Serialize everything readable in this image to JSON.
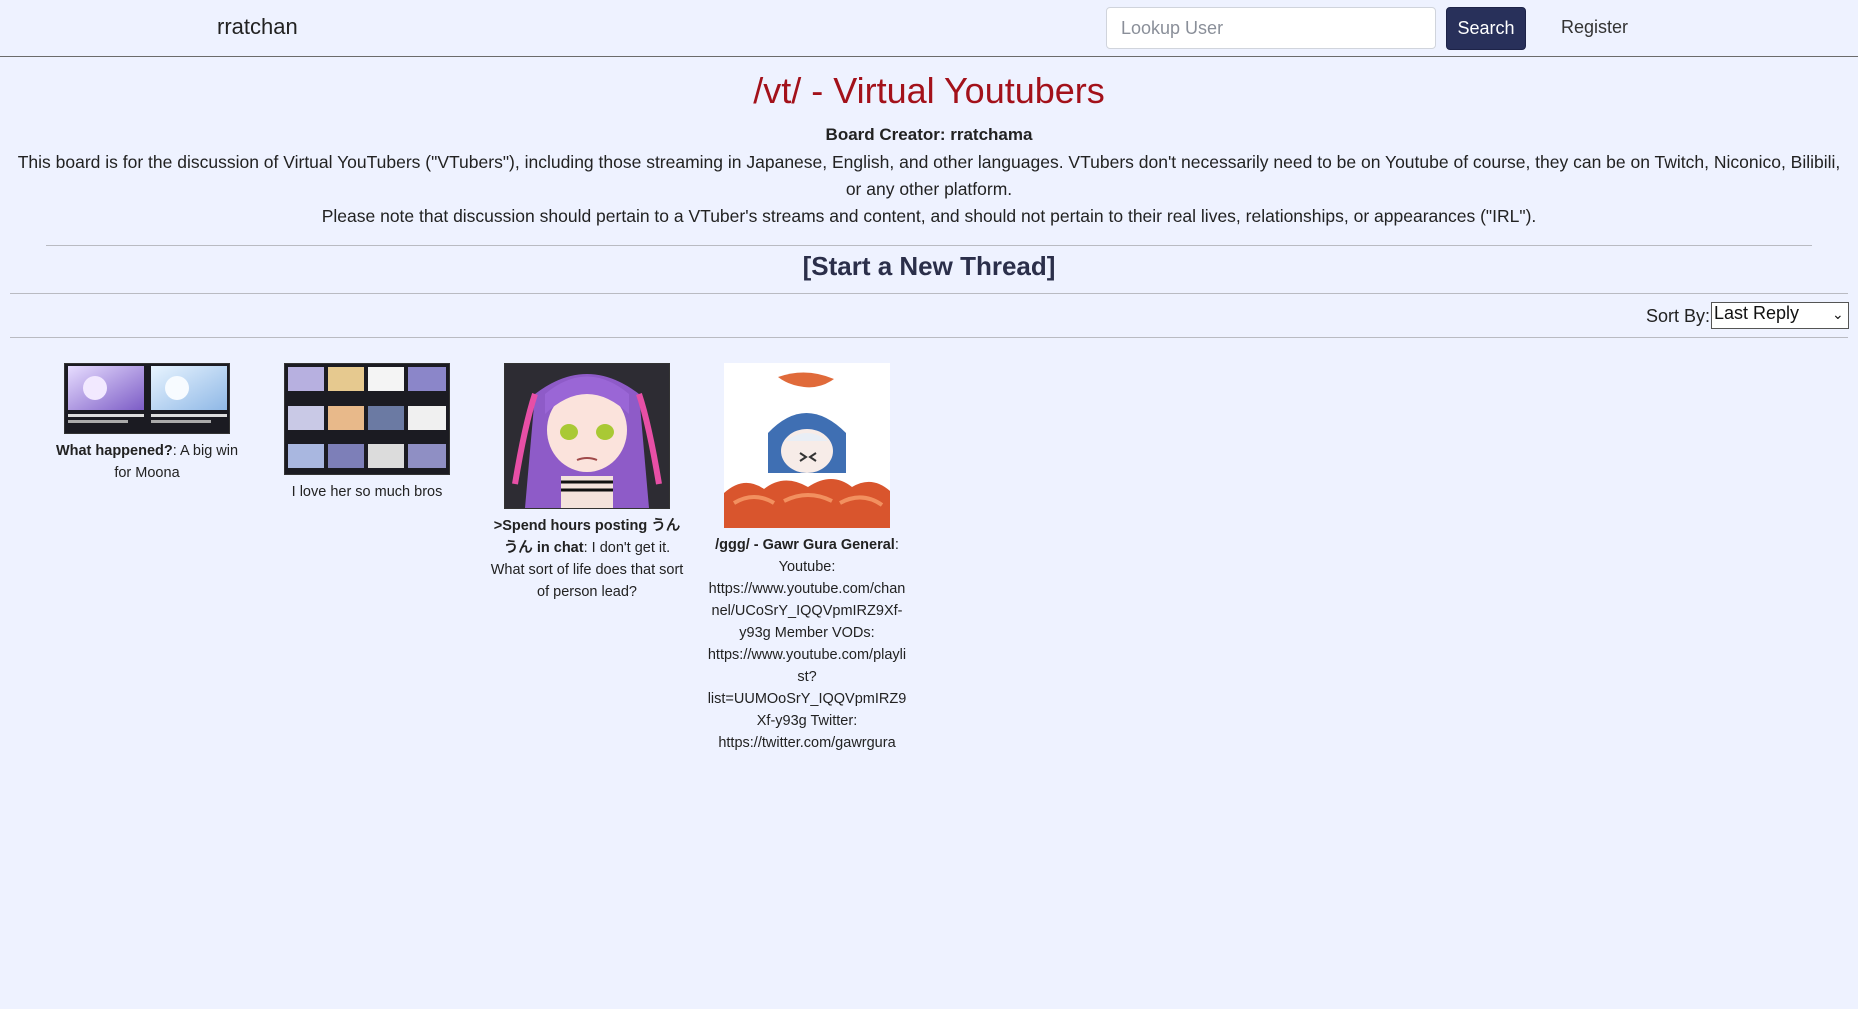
{
  "navbar": {
    "brand": "rratchan",
    "search_placeholder": "Lookup User",
    "search_label": "Search",
    "register_label": "Register"
  },
  "board": {
    "title": "/vt/ - Virtual Youtubers",
    "creator": "Board Creator: rratchama",
    "description_1": "This board is for the discussion of Virtual YouTubers (\"VTubers\"), including those streaming in Japanese, English, and other languages. VTubers don't necessarily need to be on Youtube of course, they can be on Twitch, Niconico, Bilibili, or any other platform.",
    "description_2": "Please note that discussion should pertain to a VTuber's streams and content, and should not pertain to their real lives, relationships, or appearances (\"IRL\")."
  },
  "new_thread_label": "[Start a New Thread]",
  "sort": {
    "label": "Sort By:",
    "selected": "Last Reply"
  },
  "threads": [
    {
      "subject": "What happened?",
      "separator": ": ",
      "body": "A big win for Moona"
    },
    {
      "subject": "",
      "separator": "",
      "body": "I love her so much bros"
    },
    {
      "subject": ">Spend hours posting うんうん in chat",
      "separator": ": ",
      "body": "I don't get it. What sort of life does that sort of person lead?"
    },
    {
      "subject": "/ggg/ - Gawr Gura General",
      "separator": ": ",
      "body": "Youtube: https://www.youtube.com/channel/UCoSrY_IQQVpmIRZ9Xf-y93g Member VODs: https://www.youtube.com/playlist?list=UUMOoSrY_IQQVpmIRZ9Xf-y93g Twitter: https://twitter.com/gawrgura"
    }
  ],
  "colors": {
    "background": "#eef2ff",
    "title": "#a3111a",
    "button": "#28305a"
  }
}
